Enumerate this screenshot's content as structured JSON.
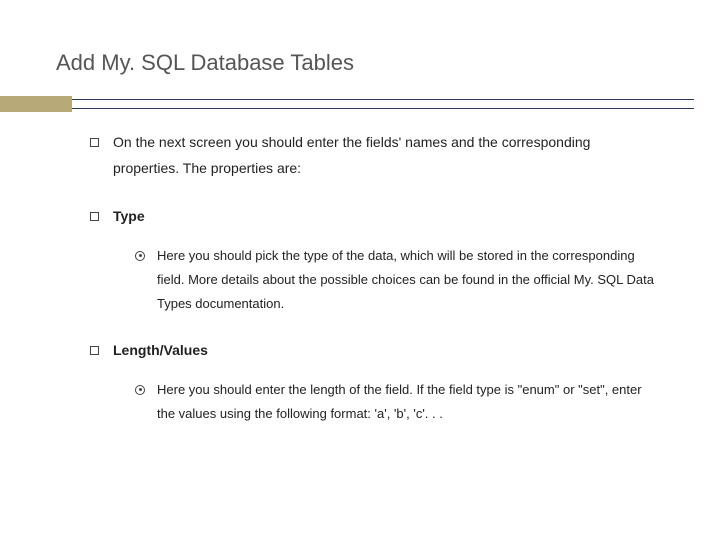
{
  "title": "Add My. SQL Database Tables",
  "items": [
    {
      "text": "On the next screen you should enter the fields' names and the corresponding properties. The properties are:",
      "bold": false,
      "children": []
    },
    {
      "text": "Type",
      "bold": true,
      "children": [
        {
          "text": "Here you should pick the type of the data, which will be stored in the corresponding field. More details about the possible choices can be found in the official My. SQL Data Types documentation."
        }
      ]
    },
    {
      "text": "Length/Values",
      "bold": true,
      "children": [
        {
          "text": "Here you should enter the length of the field.  If the field type is \"enum\" or \"set\", enter the values using the following format: 'a', 'b', 'c'. . ."
        }
      ]
    }
  ]
}
